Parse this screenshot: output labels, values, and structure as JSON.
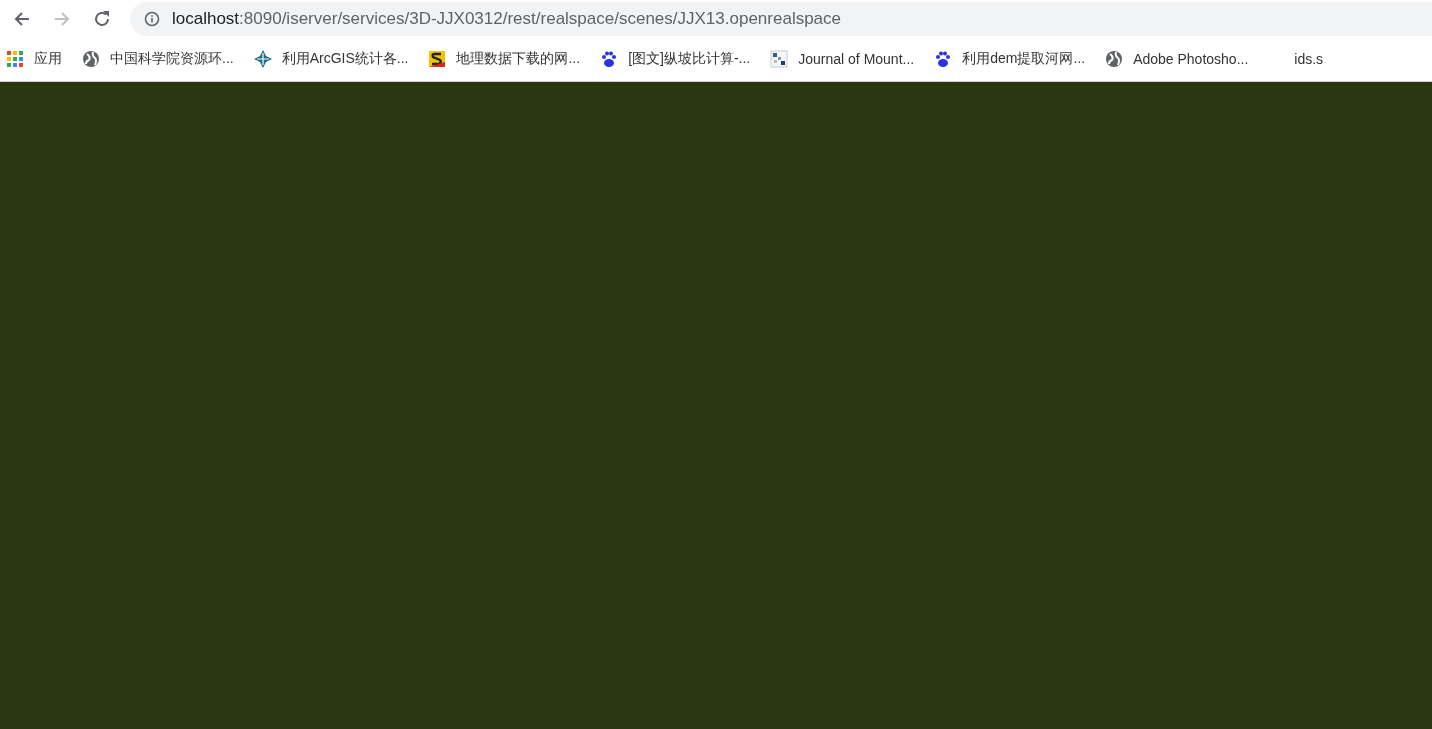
{
  "address_bar": {
    "host": "localhost",
    "path": ":8090/iserver/services/3D-JJX0312/rest/realspace/scenes/JJX13.openrealspace"
  },
  "nav_buttons": [
    {
      "kind": "back",
      "disabled": false
    },
    {
      "kind": "forward",
      "disabled": true
    },
    {
      "kind": "reload",
      "disabled": false
    }
  ],
  "bookmarks": [
    {
      "kind": "apps",
      "label": "应用"
    },
    {
      "kind": "globe",
      "label": "中国科学院资源环..."
    },
    {
      "kind": "compass",
      "label": "利用ArcGIS统计各..."
    },
    {
      "kind": "s-logo",
      "label": "地理数据下载的网..."
    },
    {
      "kind": "paw",
      "label": "[图文]纵坡比计算-..."
    },
    {
      "kind": "tiles",
      "label": "Journal of Mount..."
    },
    {
      "kind": "paw",
      "label": "利用dem提取河网..."
    },
    {
      "kind": "globe",
      "label": "Adobe Photosho..."
    },
    {
      "kind": "none",
      "label": "ids.s"
    }
  ]
}
